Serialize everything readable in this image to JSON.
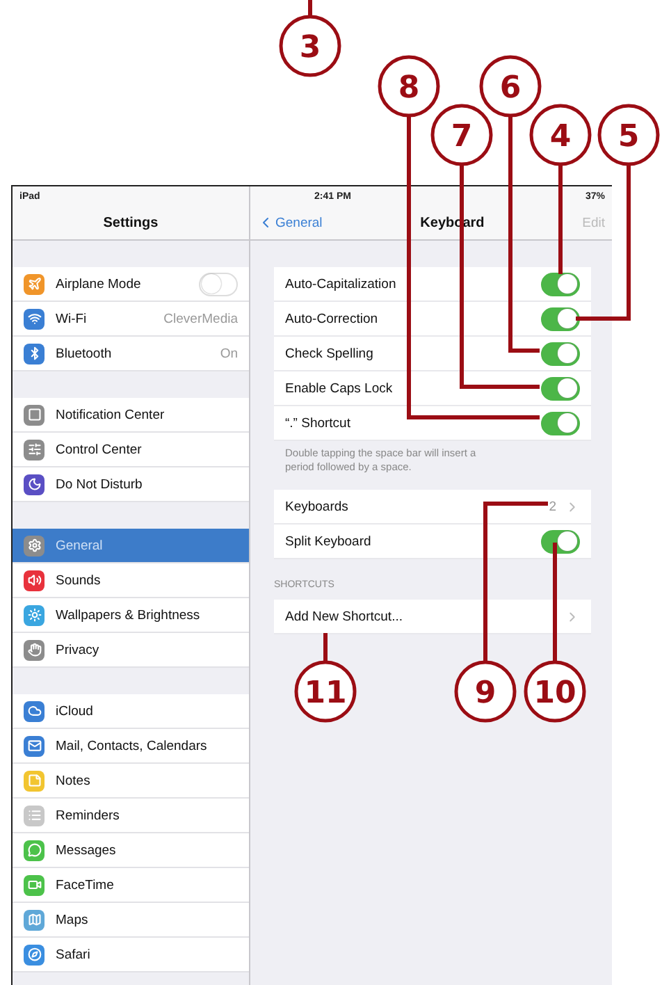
{
  "callouts": [
    "3",
    "8",
    "7",
    "6",
    "4",
    "5",
    "11",
    "9",
    "10"
  ],
  "sidebar": {
    "status": {
      "device": "iPad"
    },
    "title": "Settings",
    "groups": [
      {
        "items": [
          {
            "label": "Airplane Mode",
            "kind": "plane",
            "color": "#f0952a",
            "toggle": false,
            "selected": false
          },
          {
            "label": "Wi-Fi",
            "value": "CleverMedia",
            "kind": "wifi",
            "color": "#3a7fd4",
            "selected": false
          },
          {
            "label": "Bluetooth",
            "value": "On",
            "kind": "bluetooth",
            "color": "#3a7fd4",
            "selected": false
          }
        ]
      },
      {
        "items": [
          {
            "label": "Notification Center",
            "kind": "square",
            "color": "#8c8c8c",
            "selected": false
          },
          {
            "label": "Control Center",
            "kind": "sliders",
            "color": "#8c8c8c",
            "selected": false
          },
          {
            "label": "Do Not Disturb",
            "kind": "moon",
            "color": "#5a4fc4",
            "selected": false
          }
        ]
      },
      {
        "items": [
          {
            "label": "General",
            "kind": "gear",
            "color": "#8c8c8c",
            "selected": true
          },
          {
            "label": "Sounds",
            "kind": "speaker",
            "color": "#e8323c",
            "selected": false
          },
          {
            "label": "Wallpapers & Brightness",
            "kind": "sun",
            "color": "#3aa6e0",
            "selected": false
          },
          {
            "label": "Privacy",
            "kind": "hand",
            "color": "#8c8c8c",
            "selected": false
          }
        ]
      },
      {
        "items": [
          {
            "label": "iCloud",
            "kind": "cloud",
            "color": "#3a7fd4",
            "selected": false
          },
          {
            "label": "Mail, Contacts, Calendars",
            "kind": "mail",
            "color": "#3a7fd4",
            "selected": false
          },
          {
            "label": "Notes",
            "kind": "note",
            "color": "#f2c530",
            "selected": false
          },
          {
            "label": "Reminders",
            "kind": "list",
            "color": "#c8c8c8",
            "selected": false
          },
          {
            "label": "Messages",
            "kind": "bubble",
            "color": "#4cc24a",
            "selected": false
          },
          {
            "label": "FaceTime",
            "kind": "video",
            "color": "#4cc24a",
            "selected": false
          },
          {
            "label": "Maps",
            "kind": "map",
            "color": "#5fa8d8",
            "selected": false
          },
          {
            "label": "Safari",
            "kind": "compass",
            "color": "#3a8ee0",
            "selected": false
          }
        ]
      }
    ]
  },
  "detail": {
    "status": {
      "time": "2:41 PM",
      "battery": "37%"
    },
    "back": "General",
    "title": "Keyboard",
    "action": "Edit",
    "groups": [
      {
        "rows": [
          {
            "kind": "toggle",
            "label": "Auto-Capitalization",
            "on": true
          },
          {
            "kind": "toggle",
            "label": "Auto-Correction",
            "on": true
          },
          {
            "kind": "toggle",
            "label": "Check Spelling",
            "on": true
          },
          {
            "kind": "toggle",
            "label": "Enable Caps Lock",
            "on": true
          },
          {
            "kind": "toggle",
            "label": "“.” Shortcut",
            "on": true
          }
        ],
        "footer": "Double tapping the space bar will insert a period followed by a space."
      },
      {
        "rows": [
          {
            "kind": "link",
            "label": "Keyboards",
            "value": "2"
          },
          {
            "kind": "toggle",
            "label": "Split Keyboard",
            "on": true
          }
        ]
      },
      {
        "header": "SHORTCUTS",
        "rows": [
          {
            "kind": "link",
            "label": "Add New Shortcut..."
          }
        ]
      }
    ]
  }
}
